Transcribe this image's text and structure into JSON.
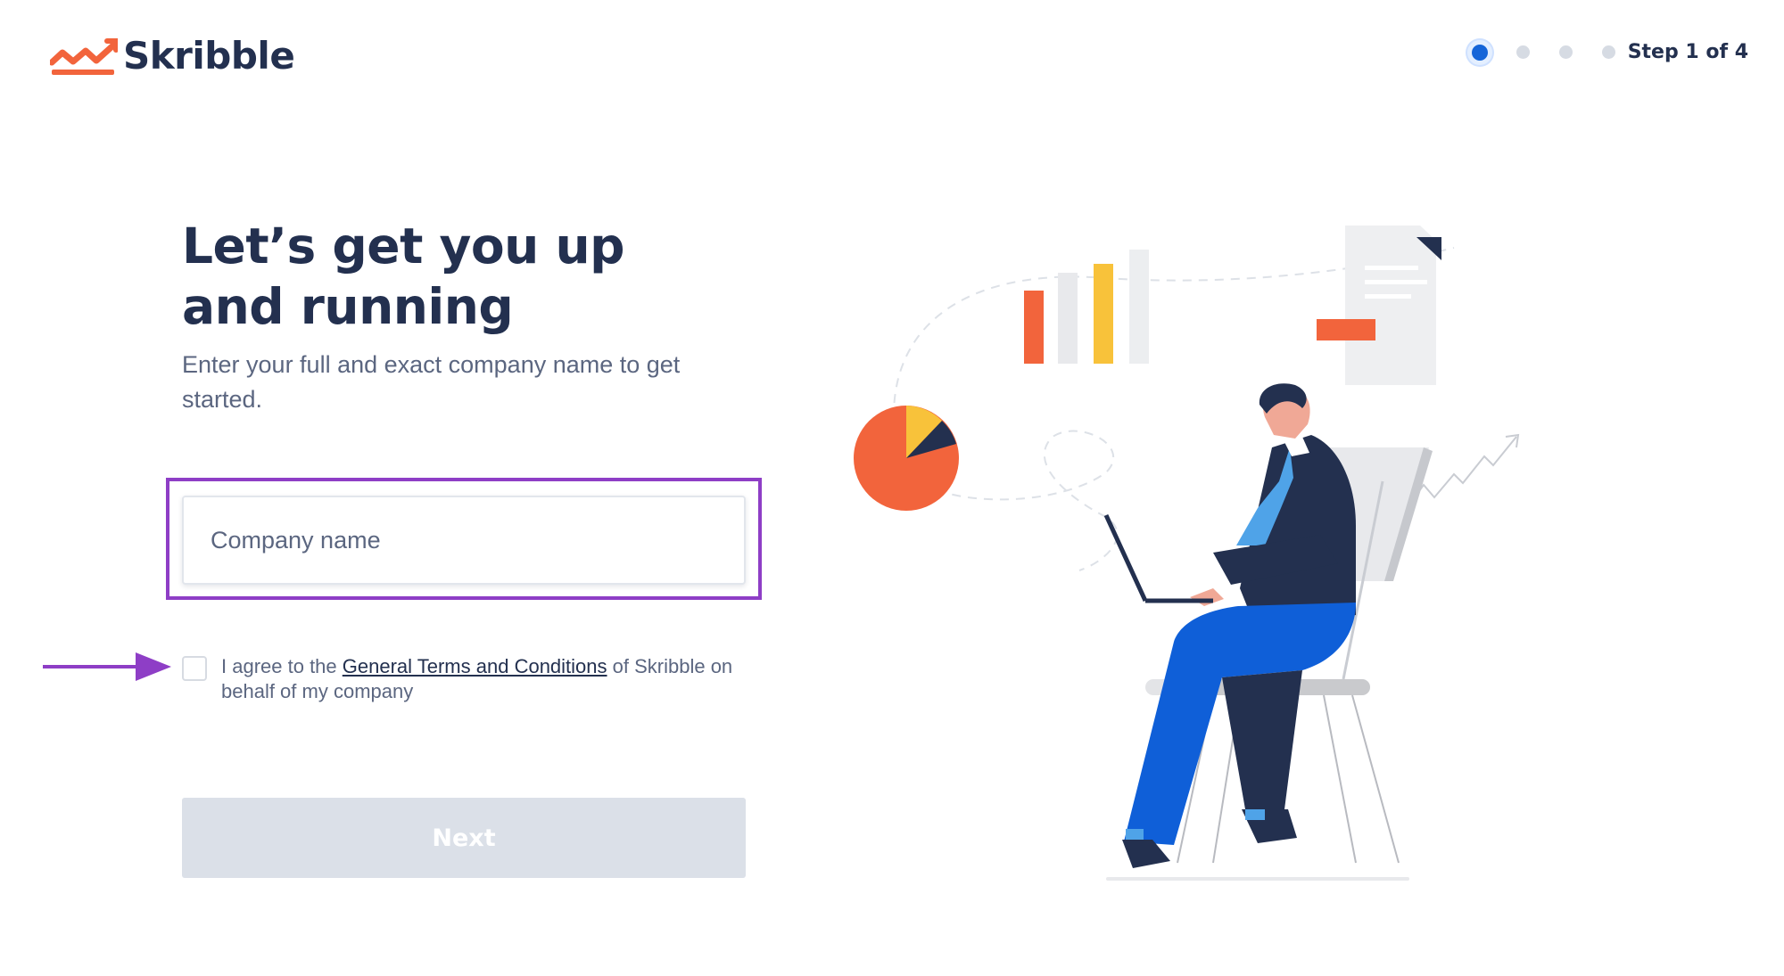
{
  "header": {
    "brand": "Skribble",
    "step_label": "Step 1 of 4",
    "steps_total": 4,
    "current_step": 1
  },
  "main": {
    "headline": "Let’s get you up and running",
    "subtext": "Enter your full and exact company name to get started.",
    "company_input": {
      "placeholder": "Company name",
      "value": ""
    },
    "agreement": {
      "text_before": "I agree to the ",
      "link_text": "General Terms and Conditions",
      "text_after": " of Skribble on behalf of my company",
      "checked": false
    },
    "next_button": "Next"
  },
  "colors": {
    "brand_navy": "#23304f",
    "brand_orange": "#f2643c",
    "active_step": "#1565d8",
    "highlight_purple": "#8e3ec6",
    "disabled_button": "#dbe0e8"
  },
  "icons": {
    "logo": "skribble-logo-icon",
    "annotation_arrow": "arrow-right-icon"
  }
}
